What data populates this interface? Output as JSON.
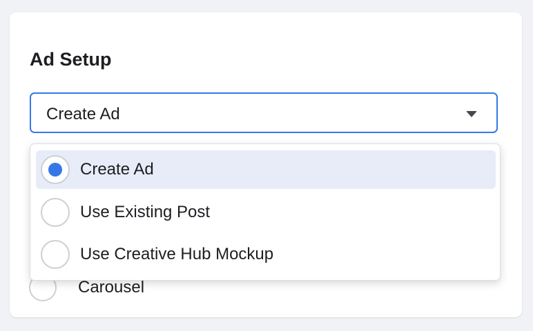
{
  "section": {
    "title": "Ad Setup"
  },
  "select": {
    "value": "Create Ad",
    "options": [
      {
        "label": "Create Ad",
        "selected": true
      },
      {
        "label": "Use Existing Post",
        "selected": false
      },
      {
        "label": "Use Creative Hub Mockup",
        "selected": false
      }
    ]
  },
  "format_options": {
    "partially_visible_label": "Carousel"
  },
  "colors": {
    "accent": "#3578e5",
    "selected_background": "#e7ecf8",
    "page_background": "#f0f2f5",
    "text": "#1c1e21"
  },
  "icons": {
    "select_caret": "caret-down-icon"
  }
}
